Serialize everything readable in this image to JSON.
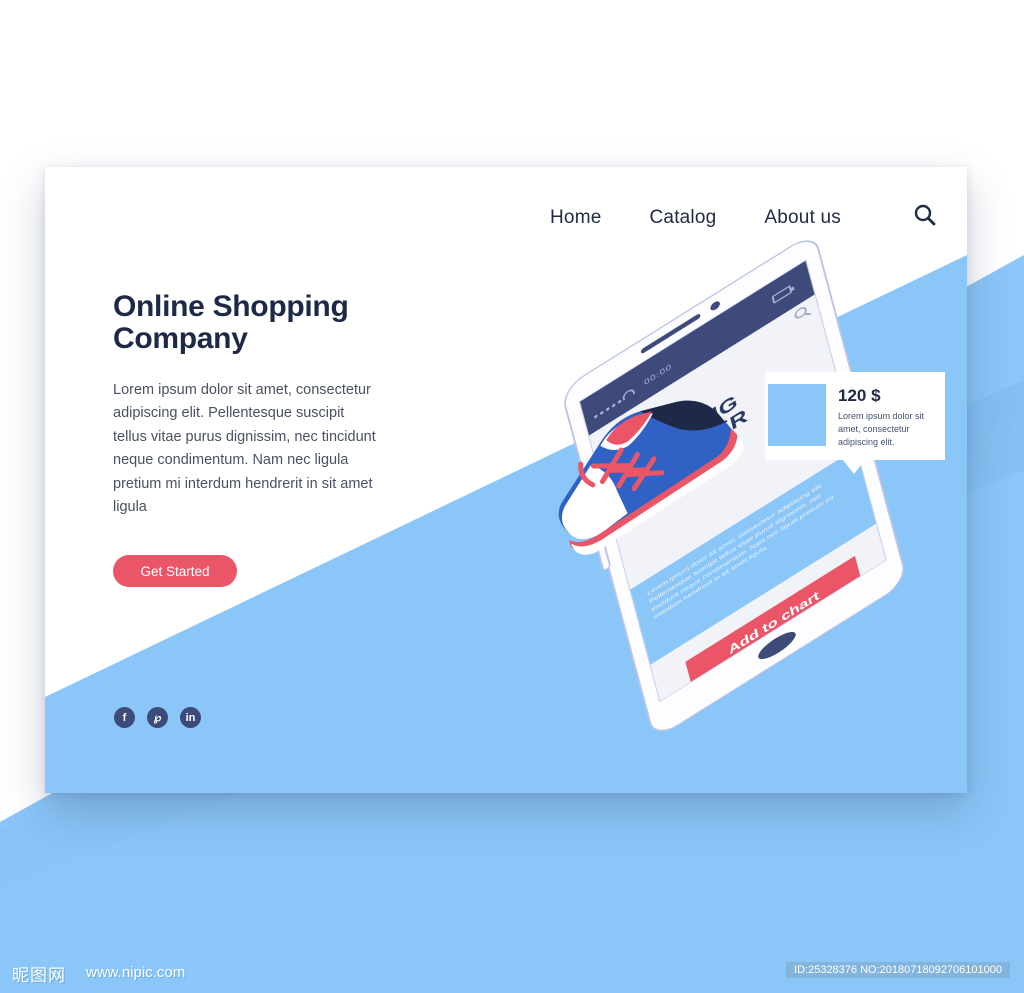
{
  "colors": {
    "accent_red": "#ea5568",
    "brand_blue": "#8ac6f8",
    "navy": "#1d2947",
    "status_navy": "#3d4a7a"
  },
  "nav": {
    "items": [
      {
        "label": "Home",
        "name": "nav-link-home"
      },
      {
        "label": "Catalog",
        "name": "nav-link-catalog"
      },
      {
        "label": "About us",
        "name": "nav-link-about-us"
      }
    ],
    "search_icon": "search-icon"
  },
  "hero": {
    "headline": "Online Shopping Company",
    "body": "Lorem ipsum dolor sit amet, consectetur adipiscing elit. Pellentesque suscipit tellus vitae purus dignissim, nec tincidunt neque condimentum. Nam nec ligula pretium mi interdum hendrerit in sit amet ligula",
    "cta_label": "Get Started"
  },
  "social": [
    {
      "label": "f",
      "name": "facebook-icon"
    },
    {
      "label": "℘",
      "name": "pinterest-icon"
    },
    {
      "label": "in",
      "name": "linkedin-icon"
    }
  ],
  "phone": {
    "status": {
      "time": "00:00",
      "wifi_icon": "wifi-icon",
      "battery_icon": "battery-icon",
      "signal_icon": "signal-dots-icon"
    },
    "menu_icon": "hamburger-menu-icon",
    "search_icon": "search-icon",
    "product_title": "RUNNING SNEAKER",
    "description": "Lorem ipsum dolor sit amet, consectetur adipiscing elit. Pellentesque suscipit tellus vitae purus dignissim, nec tincidunt neque condimentum. Nam nec ligula pretium mi interdum hendrerit in sit amet ligula.",
    "add_button_label": "Add to chart",
    "home_button": "home-button"
  },
  "price_card": {
    "price": "120 $",
    "description": "Lorem ipsum dolor sit amet, consectetur adipiscing elit."
  },
  "footer": {
    "logo": "昵图网",
    "url": "www.nipic.com",
    "id_text": "ID:25328376 NO:20180718092706101000"
  }
}
